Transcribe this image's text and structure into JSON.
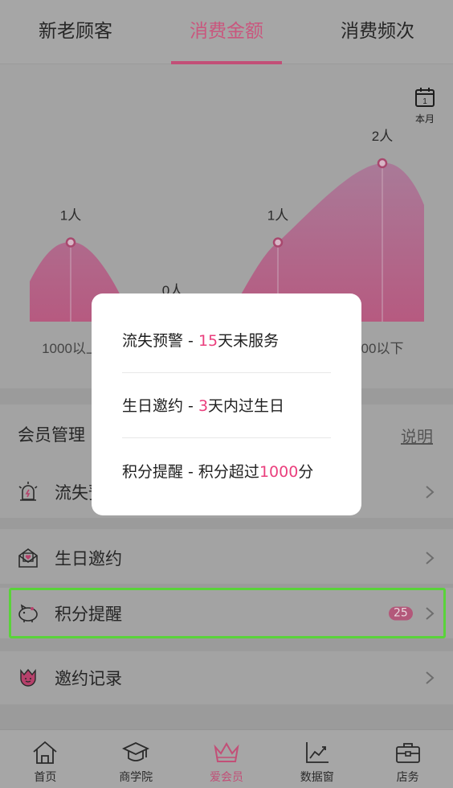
{
  "tabs": [
    {
      "label": "新老顾客",
      "active": false
    },
    {
      "label": "消费金额",
      "active": true
    },
    {
      "label": "消费频次",
      "active": false
    }
  ],
  "calendar": {
    "day": "1",
    "label": "本月",
    "icon": "calendar-icon"
  },
  "chart_data": {
    "type": "area",
    "categories": [
      "1000以上",
      "",
      "",
      "500以下"
    ],
    "visible_category_labels": [
      "1000以上",
      "00以下"
    ],
    "values": [
      1,
      0,
      1,
      2
    ],
    "data_labels": [
      "1人",
      "0人",
      "1人",
      "2人"
    ],
    "series": [
      {
        "values": [
          1,
          0,
          1,
          2
        ],
        "color": "#c9577e"
      }
    ],
    "grid": false
  },
  "section": {
    "title": "会员管理",
    "link": "说明"
  },
  "rows": [
    {
      "label": "流失预警",
      "icon": "alarm-light-icon",
      "badge": null
    },
    {
      "label": "生日邀约",
      "icon": "heart-envelope-icon",
      "badge": null
    },
    {
      "label": "积分提醒",
      "icon": "piggy-bank-icon",
      "badge": "25"
    },
    {
      "label": "邀约记录",
      "icon": "tulip-icon",
      "badge": null
    }
  ],
  "modal": {
    "items": [
      {
        "prefix": "流失预警 - ",
        "highlight": "15",
        "suffix": "天未服务"
      },
      {
        "prefix": "生日邀约 - ",
        "highlight": "3",
        "suffix": "天内过生日"
      },
      {
        "prefix": "积分提醒 - 积分超过",
        "highlight": "1000",
        "suffix": "分"
      }
    ]
  },
  "tabbar": [
    {
      "label": "首页",
      "icon": "home-icon",
      "active": false
    },
    {
      "label": "商学院",
      "icon": "graduation-cap-icon",
      "active": false
    },
    {
      "label": "爱会员",
      "icon": "crown-icon",
      "active": true
    },
    {
      "label": "数据窗",
      "icon": "chart-icon",
      "active": false
    },
    {
      "label": "店务",
      "icon": "briefcase-icon",
      "active": false
    }
  ],
  "colors": {
    "accent": "#c24f77",
    "highlight": "#ea3f7d",
    "selection": "#5ad33a"
  }
}
